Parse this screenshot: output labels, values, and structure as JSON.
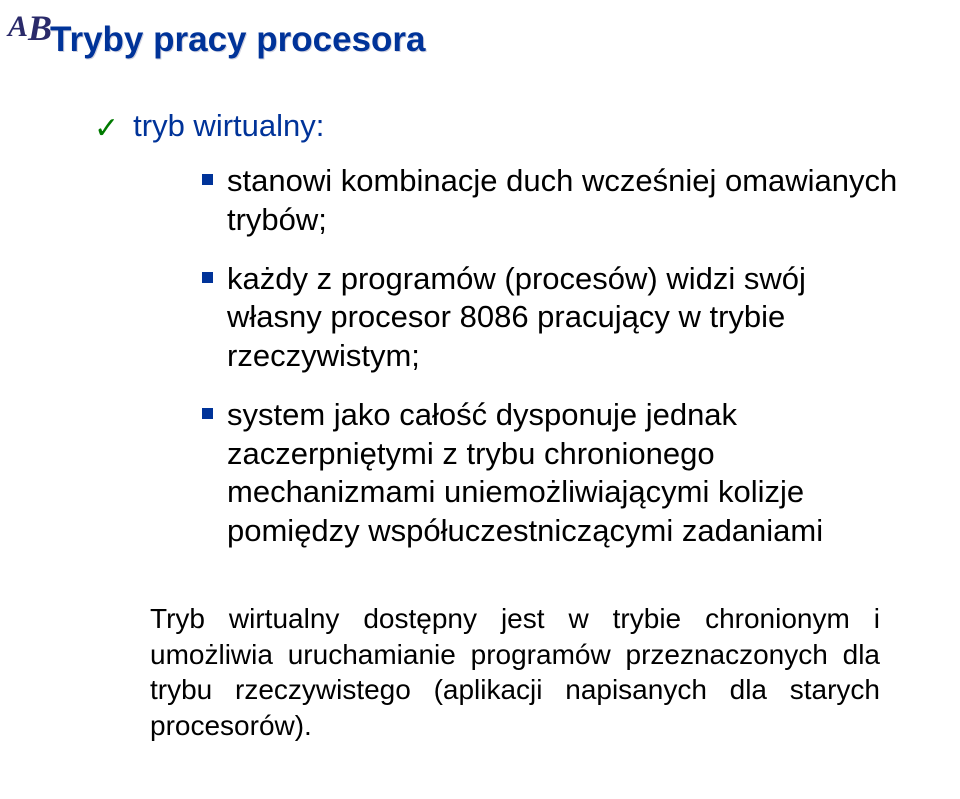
{
  "logo": {
    "a": "A",
    "b": "B"
  },
  "title": "Tryby pracy procesora",
  "section": {
    "heading": "tryb wirtualny:",
    "bullets": [
      "stanowi kombinacje duch wcześniej omawianych trybów;",
      "każdy z programów (procesów) widzi swój własny procesor 8086 pracujący w trybie rzeczywistym;",
      "system jako całość dysponuje jednak zaczerpniętymi z trybu chronionego mechanizmami uniemożliwiającymi kolizje pomiędzy współuczestniczącymi zadaniami"
    ]
  },
  "paragraph": "Tryb wirtualny dostępny jest w trybie chronionym i umożliwia uruchamianie programów przeznaczonych dla trybu rzeczywistego (aplikacji napisanych dla starych procesorów)."
}
